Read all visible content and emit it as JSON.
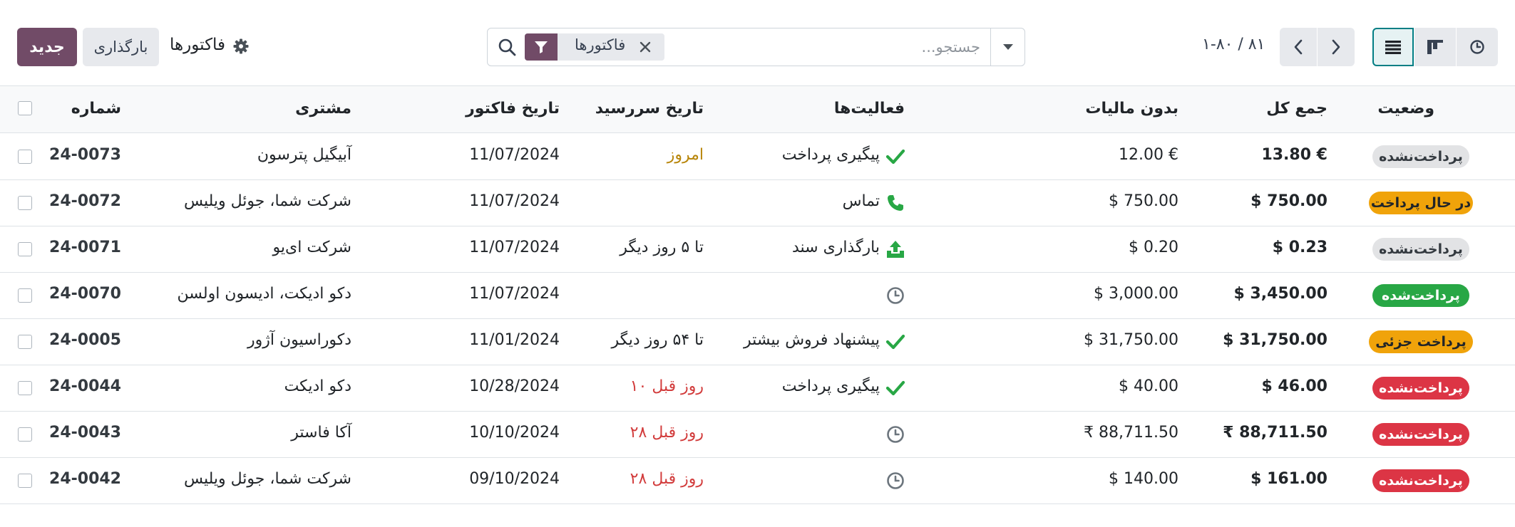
{
  "toolbar": {
    "new_label": "جدید",
    "upload_label": "بارگذاری",
    "breadcrumb": "فاکتورها"
  },
  "search": {
    "facet_label": "فاکتورها",
    "placeholder": "جستجو...",
    "value": ""
  },
  "pager": {
    "value": "۱-۸۰ / ۸۱"
  },
  "colors": {
    "primary": "#714b67",
    "view_active_border": "#017e84",
    "green": "#28a745",
    "danger": "#dc3545",
    "warning": "#f0a30a",
    "muted_badge": "#e2e3e5"
  },
  "table": {
    "columns": {
      "status": "وضعیت",
      "total": "جمع کل",
      "untaxed": "بدون مالیات",
      "activities": "فعالیت‌ها",
      "due_date": "تاریخ سررسید",
      "invoice_date": "تاریخ فاکتور",
      "customer": "مشتری",
      "number": "شماره"
    },
    "rows": [
      {
        "status": "پرداخت‌نشده",
        "status_style": "muted",
        "total": "13.80 €",
        "untaxed": "12.00 €",
        "activity_icon": "check-icon",
        "activity": "پیگیری پرداخت",
        "due": "امروز",
        "due_style": "today",
        "invoice_date": "11/07/2024",
        "customer": "آبیگیل پترسون",
        "number": "24-0073"
      },
      {
        "status": "در حال پرداخت",
        "status_style": "warning",
        "total": "$ 750.00",
        "untaxed": "$ 750.00",
        "activity_icon": "phone-icon",
        "activity": "تماس",
        "due": "",
        "due_style": "normal",
        "invoice_date": "11/07/2024",
        "customer": "شرکت شما، جوئل ویلیس",
        "number": "24-0072"
      },
      {
        "status": "پرداخت‌نشده",
        "status_style": "muted",
        "total": "$ 0.23",
        "untaxed": "$ 0.20",
        "activity_icon": "upload-icon",
        "activity": "بارگذاری سند",
        "due": "تا ۵ روز دیگر",
        "due_style": "normal",
        "invoice_date": "11/07/2024",
        "customer": "شرکت ای‌یو",
        "number": "24-0071"
      },
      {
        "status": "پرداخت‌شده",
        "status_style": "success",
        "total": "$ 3,450.00",
        "untaxed": "$ 3,000.00",
        "activity_icon": "clock-icon",
        "activity": "",
        "due": "",
        "due_style": "normal",
        "invoice_date": "11/07/2024",
        "customer": "دکو ادیکت، ادیسون اولسن",
        "number": "24-0070"
      },
      {
        "status": "پرداخت جزئی",
        "status_style": "warning",
        "total": "$ 31,750.00",
        "untaxed": "$ 31,750.00",
        "activity_icon": "check-icon",
        "activity": "پیشنهاد فروش بیشتر",
        "due": "تا ۵۴ روز دیگر",
        "due_style": "normal",
        "invoice_date": "11/01/2024",
        "customer": "دکوراسیون آژور",
        "number": "24-0005"
      },
      {
        "status": "پرداخت‌نشده",
        "status_style": "danger",
        "total": "$ 46.00",
        "untaxed": "$ 40.00",
        "activity_icon": "check-icon",
        "activity": "پیگیری پرداخت",
        "due": "۱۰ روز قبل",
        "due_style": "overdue",
        "invoice_date": "10/28/2024",
        "customer": "دکو ادیکت",
        "number": "24-0044"
      },
      {
        "status": "پرداخت‌نشده",
        "status_style": "danger",
        "total": "₹ 88,711.50",
        "untaxed": "₹ 88,711.50",
        "activity_icon": "clock-icon",
        "activity": "",
        "due": "۲۸ روز قبل",
        "due_style": "overdue",
        "invoice_date": "10/10/2024",
        "customer": "آکا فاستر",
        "number": "24-0043"
      },
      {
        "status": "پرداخت‌نشده",
        "status_style": "danger",
        "total": "$ 161.00",
        "untaxed": "$ 140.00",
        "activity_icon": "clock-icon",
        "activity": "",
        "due": "۲۸ روز قبل",
        "due_style": "overdue",
        "invoice_date": "09/10/2024",
        "customer": "شرکت شما، جوئل ویلیس",
        "number": "24-0042"
      }
    ]
  }
}
